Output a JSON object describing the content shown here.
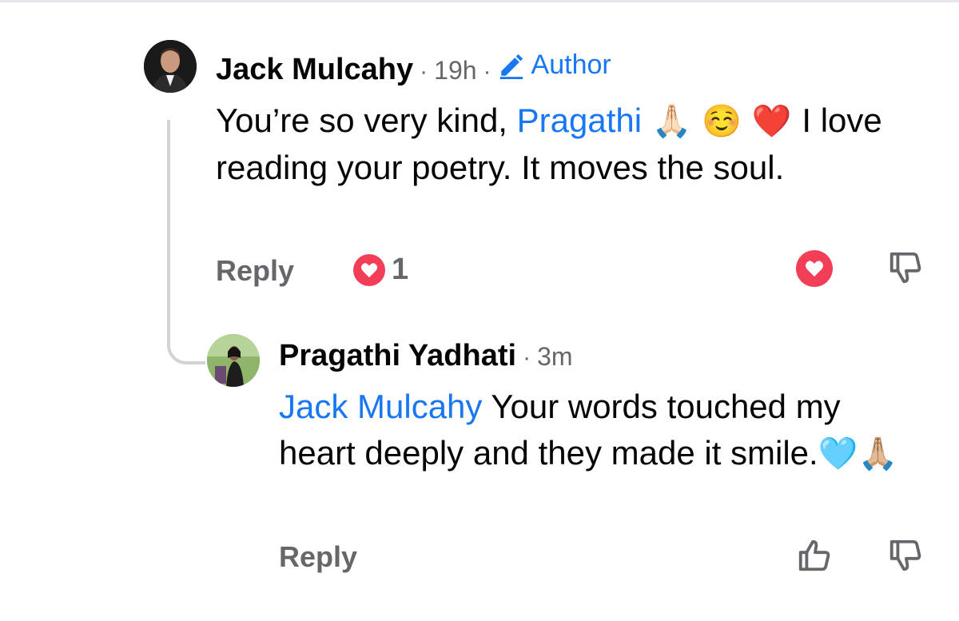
{
  "comments": [
    {
      "author": "Jack Mulcahy",
      "time": "19h",
      "badge": "Author",
      "body_pre": "You’re so very kind, ",
      "mention": "Pragathi",
      "body_emoji": " 🙏🏻 ☺️ ❤️ ",
      "body_post": "I love reading your poetry. It moves the soul.",
      "reply_label": "Reply",
      "reaction_count": "1"
    },
    {
      "author": "Pragathi Yadhati",
      "time": "3m",
      "mention": "Jack Mulcahy",
      "body_post": " Your words touched my heart deeply and they made it smile.",
      "body_emoji": "🩵🙏🏼",
      "reply_label": "Reply"
    }
  ],
  "separator": "·",
  "icons": [
    "pencil-icon",
    "heart-icon",
    "thumbs-up-icon",
    "thumbs-down-icon"
  ],
  "colors": {
    "link": "#1877f2",
    "muted": "#65676b",
    "love": "#f33e58"
  }
}
